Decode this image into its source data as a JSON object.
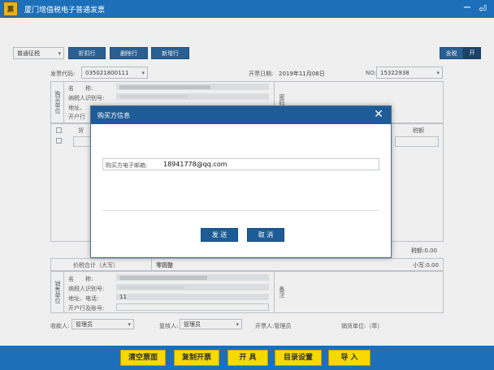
{
  "app": {
    "logo_text": "票",
    "title": "厦门增值税电子普通发票",
    "min_icon": "minimize-icon",
    "exit_icon": "exit-icon"
  },
  "toolbar": {
    "invoice_type": "普通征税",
    "buttons": [
      "折扣行",
      "删除行",
      "新增行"
    ],
    "tax_incl": "含税",
    "tax_toggle": "开"
  },
  "header": {
    "code_label": "发票代码:",
    "code_value": "035021800111",
    "date_label": "开票日期:",
    "date_value": "2019年11月08日",
    "no_label": "NO:",
    "no_value": "15322938"
  },
  "buyer": {
    "side_label": "购买单位",
    "name_label": "名　　称:",
    "tax_id_label": "纳税人识别号:",
    "address_label": "地址、",
    "bank_label": "开户行",
    "secret_label": "密码区"
  },
  "items": {
    "goods_header": "货",
    "tax_header": "税额"
  },
  "totals": {
    "tax_total": "税额:0.00",
    "amount_in_words_label": "价税合计（大写）",
    "amount_in_words": "零圆整",
    "amount_lower": "小写:0.00"
  },
  "seller": {
    "side_label": "销售单位",
    "name_label": "名　　称:",
    "tax_id_label": "纳税人识别号:",
    "address_label": "地址、电话:",
    "phone": "11",
    "bank_label": "开户行及账号:",
    "remark_label": "备注"
  },
  "footer": {
    "payee_label": "收款人:",
    "payee_value": "管理员",
    "reviewer_label": "复核人:",
    "reviewer_value": "管理员",
    "drawer_label": "开票人:管理员",
    "seller_unit": "销货单位:（章）"
  },
  "dialog": {
    "title": "购买方信息",
    "close_icon": "close-icon",
    "email_label": "购买方电子邮箱:",
    "email_value": "18941778@qq.com",
    "send": "发 送",
    "cancel": "取 消"
  },
  "bottom": {
    "buttons": [
      "清空票面",
      "复制开票",
      "开 具",
      "目录设置",
      "导 入"
    ]
  },
  "colors": {
    "primary": "#1c6fb8",
    "accent_button": "#1e5c97",
    "yellow": "#f5d900"
  }
}
